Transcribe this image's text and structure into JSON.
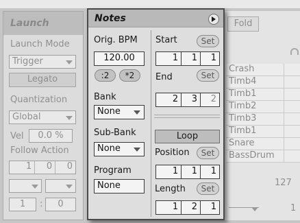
{
  "launch": {
    "title": "Launch",
    "launch_mode_label": "Launch Mode",
    "trigger_value": "Trigger",
    "legato_label": "Legato",
    "quantization_label": "Quantization",
    "quantization_value": "Global",
    "vel_label": "Vel",
    "vel_value": "0.0 %",
    "follow_action_label": "Follow Action",
    "follow_values": [
      "1",
      "0",
      "0"
    ],
    "follow_time": [
      "1",
      "0"
    ],
    "follow_sep": ":"
  },
  "notes": {
    "title": "Notes",
    "orig_bpm_label": "Orig. BPM",
    "orig_bpm_value": "120.00",
    "half_label": ":2",
    "double_label": "*2",
    "bank_label": "Bank",
    "bank_value": "None",
    "subbank_label": "Sub-Bank",
    "subbank_value": "None",
    "program_label": "Program",
    "program_value": "None",
    "start_label": "Start",
    "start_values": [
      "1",
      "1",
      "1"
    ],
    "end_label": "End",
    "end_values": [
      "2",
      "3",
      "2"
    ],
    "set_label": "Set",
    "loop_label": "Loop",
    "position_label": "Position",
    "position_values": [
      "1",
      "1",
      "1"
    ],
    "length_label": "Length",
    "length_values": [
      "1",
      "2",
      "1"
    ]
  },
  "tracks": {
    "fold_label": "Fold",
    "names": [
      "Crash",
      "Timb4",
      "Timb1",
      "Timb2",
      "Timb3",
      "Timb1",
      "Snare",
      "BassDrum"
    ],
    "value_127": "127",
    "value_1": "1"
  }
}
